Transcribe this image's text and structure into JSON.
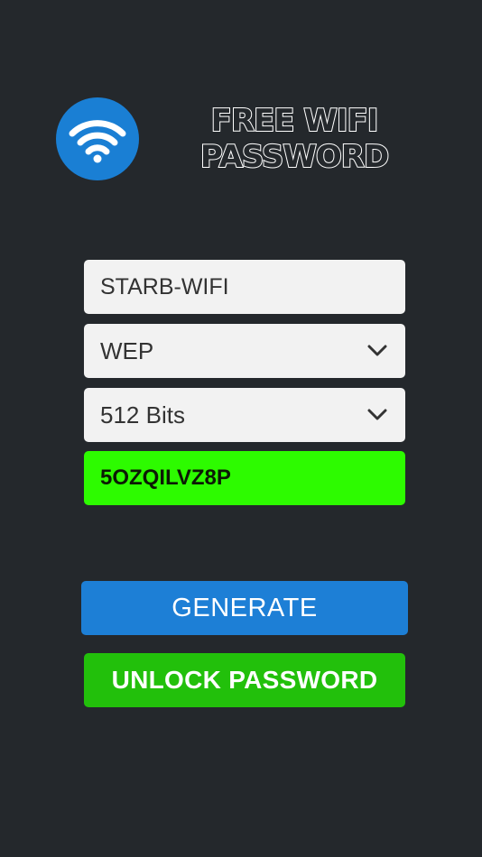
{
  "app": {
    "title_line1": "FREE WIFI",
    "title_line2": "PASSWORD",
    "logo_icon": "wifi-icon"
  },
  "form": {
    "network_name": "STARB-WIFI",
    "security_type": "WEP",
    "key_length": "512 Bits",
    "generated_password": "5OZQILVZ8P"
  },
  "actions": {
    "generate_label": "GENERATE",
    "unlock_label": "UNLOCK PASSWORD"
  },
  "colors": {
    "background": "#24282c",
    "logo_blue": "#1a7fd4",
    "field_bg": "#f2f2f2",
    "result_green": "#2dfb00",
    "generate_blue": "#1d7fd6",
    "unlock_green": "#22c00b"
  }
}
